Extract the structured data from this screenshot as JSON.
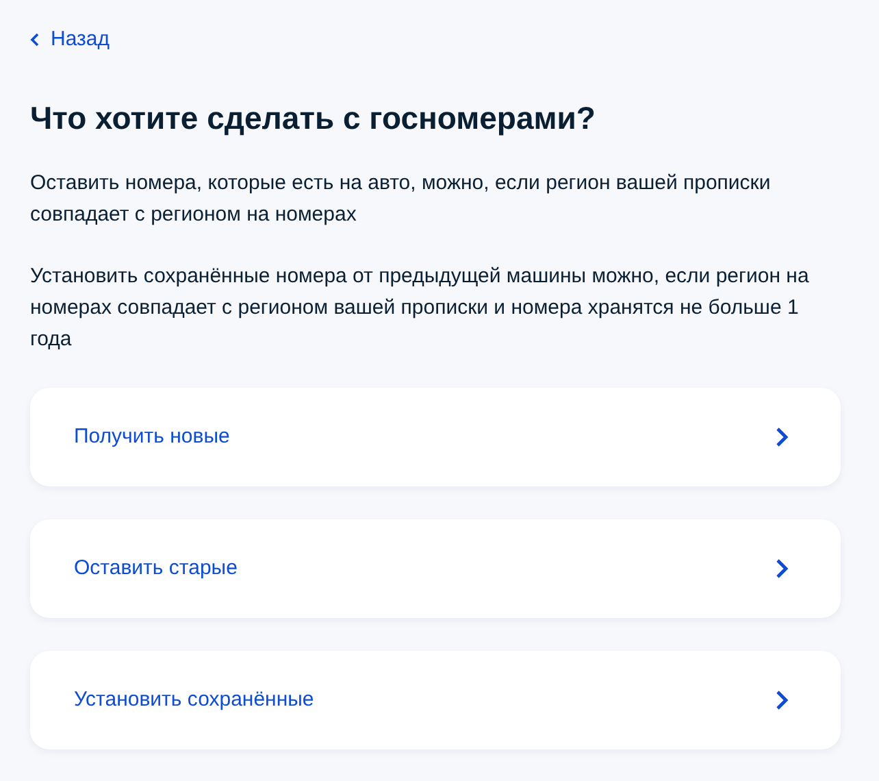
{
  "back_link": {
    "label": "Назад"
  },
  "title": "Что хотите сделать с госномерами?",
  "paragraphs": [
    "Оставить номера, которые есть на авто, можно, если регион вашей прописки совпадает с регионом на номерах",
    "Установить сохранённые номера от предыдущей машины можно, если регион на номерах совпадает с регионом вашей прописки и номера хранятся не больше 1 года"
  ],
  "options": [
    {
      "label": "Получить новые"
    },
    {
      "label": "Оставить старые"
    },
    {
      "label": "Установить сохранённые"
    }
  ]
}
